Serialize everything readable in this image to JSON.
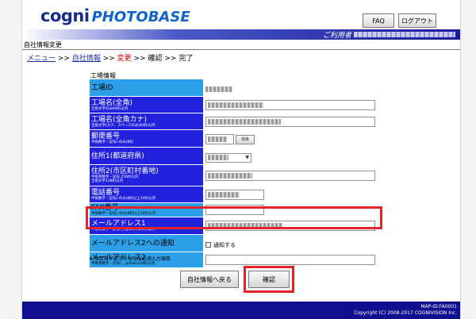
{
  "header": {
    "logo_cogni": "cogni",
    "logo_photobase": "PHOTOBASE",
    "faq_label": "FAQ",
    "logout_label": "ログアウト",
    "user_label": "ご利用者"
  },
  "page": {
    "section_title": "自社情報変更",
    "breadcrumb": {
      "menu": "メニュー",
      "sep1": " >> ",
      "company_info": "自社情報",
      "sep2": " >> ",
      "change": "変更",
      "sep3": " >> ",
      "confirm": "確認",
      "sep4": " >> ",
      "done": "完了"
    },
    "factory_title": "工場情報"
  },
  "form": {
    "factory_id": {
      "label": "工場ID"
    },
    "factory_name": {
      "label": "工場名(全角)",
      "sub": "全角文字のみ64桁以内"
    },
    "factory_kana": {
      "label": "工場名(全角カナ)",
      "sub": "全角文字(カナ、スペースのみ)64桁以内"
    },
    "postal": {
      "label": "郵便番号",
      "sub": "半角数字・記号(-のみ)8桁",
      "search_btn": "検索"
    },
    "address1": {
      "label": "住所1(都道府県)"
    },
    "address2": {
      "label": "住所2(市区町村番地)",
      "sub": "半角英数字・記号 256桁以内",
      "sub2": "全角文字128桁以内"
    },
    "phone": {
      "label": "電話番号",
      "sub": "半角数字・記号(-のみ)8桁以上16桁以内"
    },
    "fax": {
      "label": "FAX番号",
      "sub": "半角数字・記号(-のみ)8桁以上16桁以内"
    },
    "email1": {
      "label": "メールアドレス1",
      "sub": "半角英数字・記号(-_.@のみ)128桁以内"
    },
    "email2_notify": {
      "label": "メールアドレス2への通知",
      "checkbox_label": "通知する"
    },
    "email2": {
      "label": "メールアドレス2",
      "sub": "半角英数字・記号(-_.@のみ)128桁以内"
    }
  },
  "note": "※ 項目名が白字のものは必須入力項目",
  "actions": {
    "back_label": "自社情報へ戻る",
    "confirm_label": "確認"
  },
  "footer": {
    "screen_id": "MAP-ID:FA0001",
    "copyright": "Copyright (C) 2008-2017 COGNIVISION Inc."
  },
  "colors": {
    "brand_navy": "#1b2d8a",
    "required_label": "#2222dd",
    "optional_label": "#2d9ee8",
    "highlight": "#e3242b",
    "footer": "#0f0f8f"
  }
}
